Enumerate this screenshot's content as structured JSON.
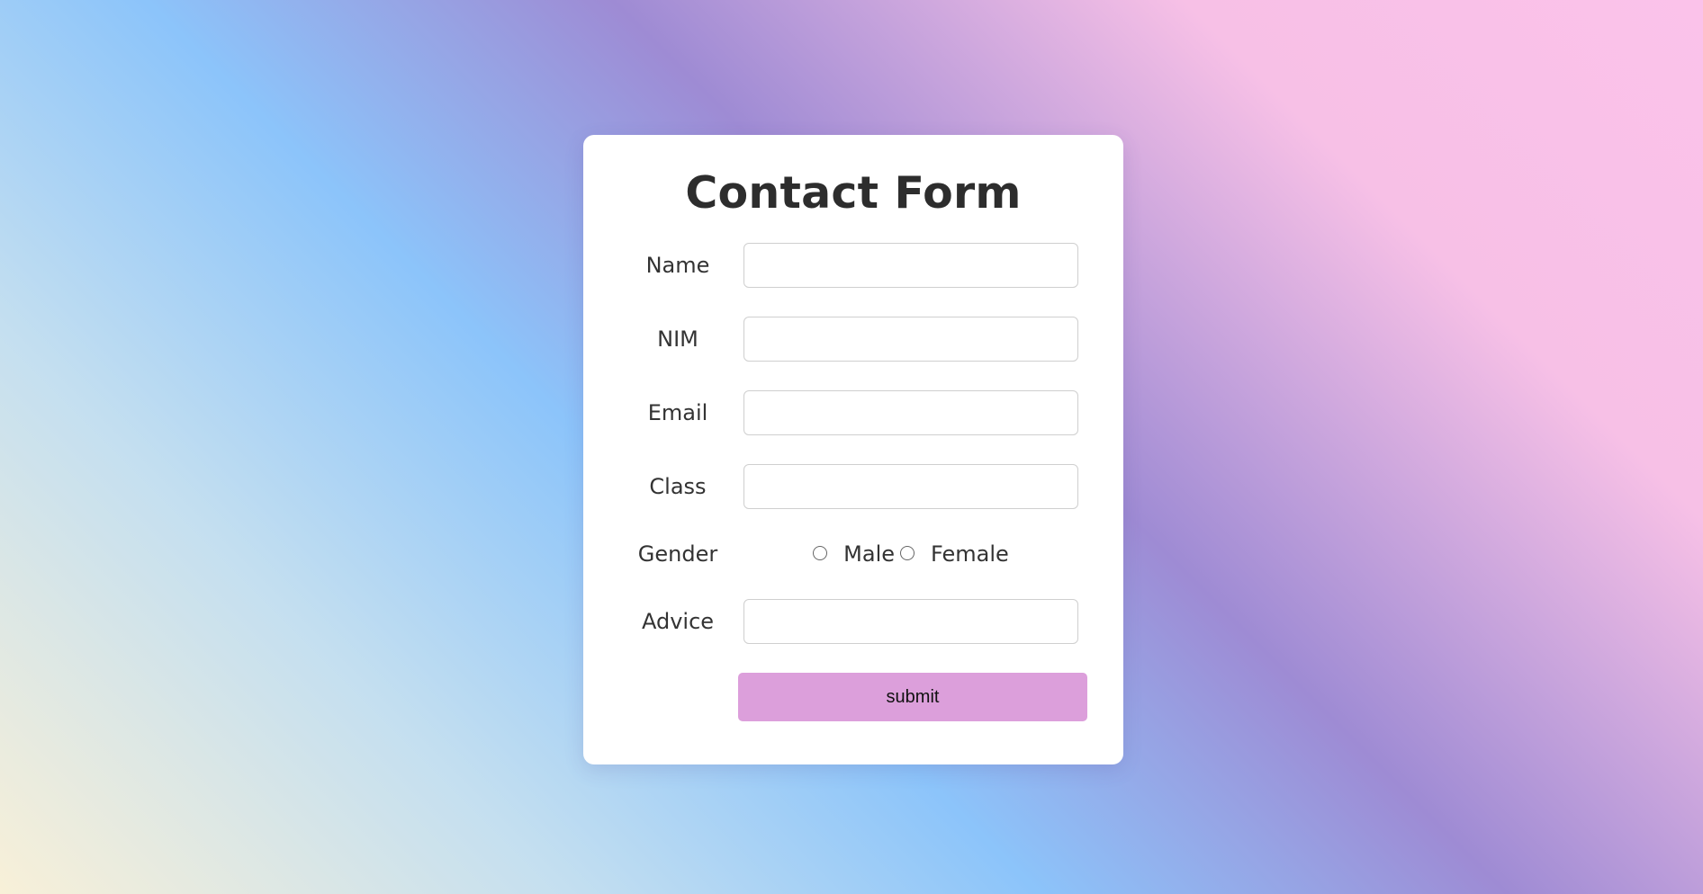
{
  "theme": {
    "card_background": "#ffffff",
    "submit_color": "#dc9fdb",
    "text_color": "#333333"
  },
  "form": {
    "title": "Contact Form",
    "fields": {
      "name": {
        "label": "Name",
        "value": ""
      },
      "nim": {
        "label": "NIM",
        "value": ""
      },
      "email": {
        "label": "Email",
        "value": ""
      },
      "class": {
        "label": "Class",
        "value": ""
      },
      "gender": {
        "label": "Gender",
        "options": [
          "Male",
          "Female"
        ],
        "selected": null
      },
      "advice": {
        "label": "Advice",
        "value": ""
      }
    },
    "submit_label": "submit"
  }
}
